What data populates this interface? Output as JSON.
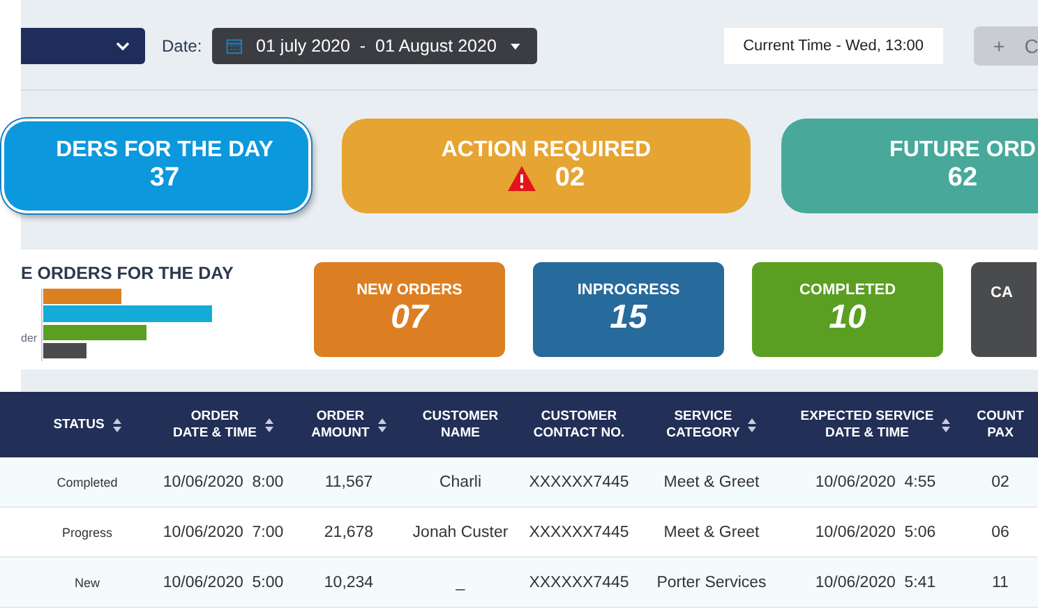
{
  "toolbar": {
    "date_label": "Date:",
    "date_range": "01 july 2020  -  01 August 2020",
    "current_time": "Current Time - Wed, 13:00",
    "add_button": {
      "icon": "+",
      "label": "C",
      "disabled": true
    }
  },
  "summary_cards": [
    {
      "title": "DERS FOR THE DAY",
      "value": "37",
      "kind": "total",
      "selected": true,
      "color": "#0c98dc",
      "warning": false
    },
    {
      "title": "ACTION REQUIRED",
      "value": "02",
      "kind": "action",
      "selected": false,
      "color": "#e6a432",
      "warning": true
    },
    {
      "title": "FUTURE ORD",
      "value": "62",
      "kind": "future",
      "selected": false,
      "color": "#48a99b",
      "warning": false
    }
  ],
  "orders_panel": {
    "title": "E ORDERS FOR THE DAY",
    "axis_label": "der",
    "status_cards": [
      {
        "title": "NEW ORDERS",
        "value": "07",
        "color": "#dc7f22"
      },
      {
        "title": "INPROGRESS",
        "value": "15",
        "color": "#276a9c"
      },
      {
        "title": "COMPLETED",
        "value": "10",
        "color": "#5a9f22"
      },
      {
        "title": "CA",
        "color": "#4a4b4d"
      }
    ]
  },
  "table": {
    "columns": [
      {
        "label": "STATUS",
        "sortable": true
      },
      {
        "label": "ORDER\nDATE & TIME",
        "sortable": true
      },
      {
        "label": "ORDER\nAMOUNT",
        "sortable": true
      },
      {
        "label": "CUSTOMER\nNAME",
        "sortable": false
      },
      {
        "label": "CUSTOMER\nCONTACT NO.",
        "sortable": false
      },
      {
        "label": "SERVICE\nCATEGORY",
        "sortable": true
      },
      {
        "label": "EXPECTED SERVICE\nDATE & TIME",
        "sortable": true
      },
      {
        "label": "COUNT\nPAX",
        "sortable": false
      }
    ],
    "rows": [
      [
        "Completed",
        "10/06/2020  8:00",
        "11,567",
        "Charli",
        "XXXXXX7445",
        "Meet & Greet",
        "10/06/2020  4:55",
        "02"
      ],
      [
        "Progress",
        "10/06/2020  7:00",
        "21,678",
        "Jonah Custer",
        "XXXXXX7445",
        "Meet & Greet",
        "10/06/2020  5:06",
        "06"
      ],
      [
        "New",
        "10/06/2020  5:00",
        "10,234",
        "_",
        "XXXXXX7445",
        "Porter Services",
        "10/06/2020  5:41",
        "11"
      ]
    ]
  }
}
